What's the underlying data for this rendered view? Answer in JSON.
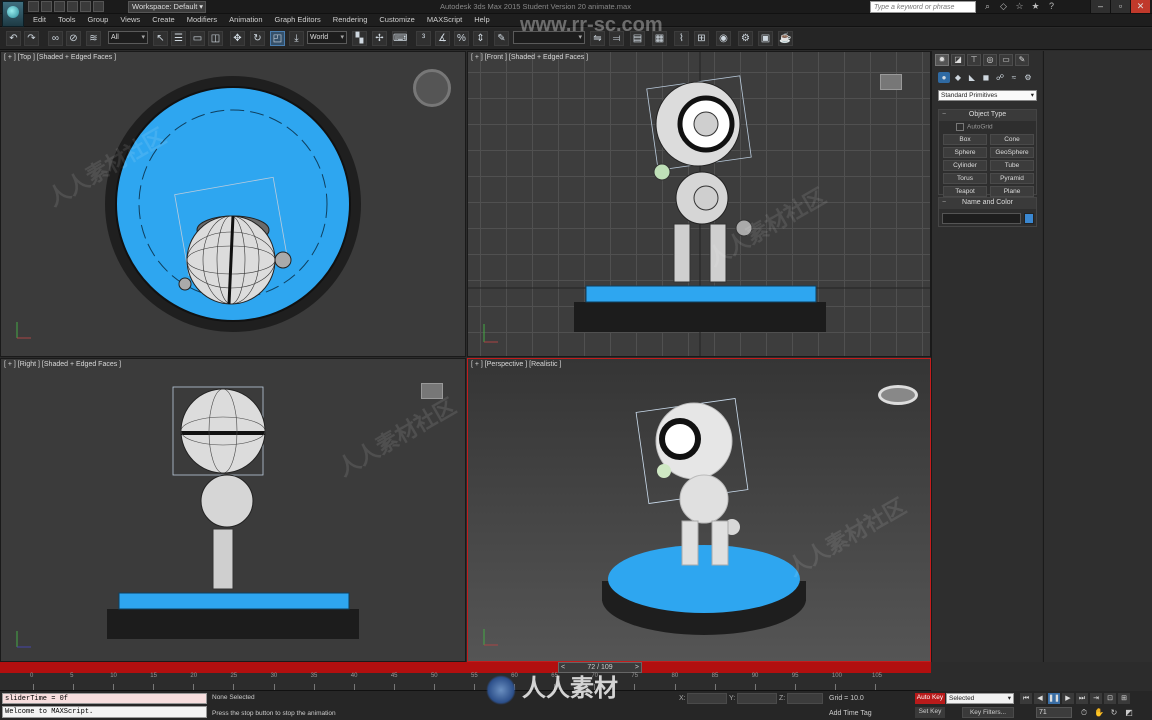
{
  "app": {
    "window_title": "Autodesk 3ds Max 2015    Student Version    20 animate.max",
    "workspace": "Workspace: Default",
    "search_placeholder": "Type a keyword or phrase"
  },
  "menu": [
    "Edit",
    "Tools",
    "Group",
    "Views",
    "Create",
    "Modifiers",
    "Animation",
    "Graph Editors",
    "Rendering",
    "Customize",
    "MAXScript",
    "Help"
  ],
  "toolbar": {
    "selection_filter": "All",
    "reference_coord": "World"
  },
  "viewports": {
    "top": "[ + ] [Top ] [Shaded + Edged Faces ]",
    "front": "[ + ] [Front ] [Shaded + Edged Faces ]",
    "right": "[ + ] [Right ] [Shaded + Edged Faces ]",
    "perspective": "[ + ] [Perspective ] [Realistic ]"
  },
  "command_panel": {
    "category": "Standard Primitives",
    "object_type_title": "Object Type",
    "autogrid": "AutoGrid",
    "primitives": [
      "Box",
      "Cone",
      "Sphere",
      "GeoSphere",
      "Cylinder",
      "Tube",
      "Torus",
      "Pyramid",
      "Teapot",
      "Plane"
    ],
    "name_color_title": "Name and Color"
  },
  "timeline": {
    "frame_display": "72 / 109",
    "ticks": [
      "0",
      "5",
      "10",
      "15",
      "20",
      "25",
      "30",
      "35",
      "40",
      "45",
      "50",
      "55",
      "60",
      "65",
      "70",
      "75",
      "80",
      "85",
      "90",
      "95",
      "100",
      "105"
    ]
  },
  "status": {
    "maxscript_line1": "sliderTime = 0f",
    "maxscript_line2": "Welcome to MAXScript.",
    "selection": "None Selected",
    "prompt": "Press the stop button to stop the animation",
    "x_label": "X:",
    "y_label": "Y:",
    "z_label": "Z:",
    "grid": "Grid = 10.0",
    "add_time_tag": "Add Time Tag",
    "auto_key": "Auto Key",
    "set_key": "Set Key",
    "selected": "Selected",
    "key_filters": "Key Filters...",
    "current_frame": "71"
  },
  "watermark": {
    "top": "www.rr-sc.com",
    "logo": "人人素材",
    "tile": "人人素材社区"
  },
  "colors": {
    "accent_blue": "#2ea6f0",
    "timeslider_red": "#b20f0f",
    "active_viewport_border": "#c41d1d"
  }
}
